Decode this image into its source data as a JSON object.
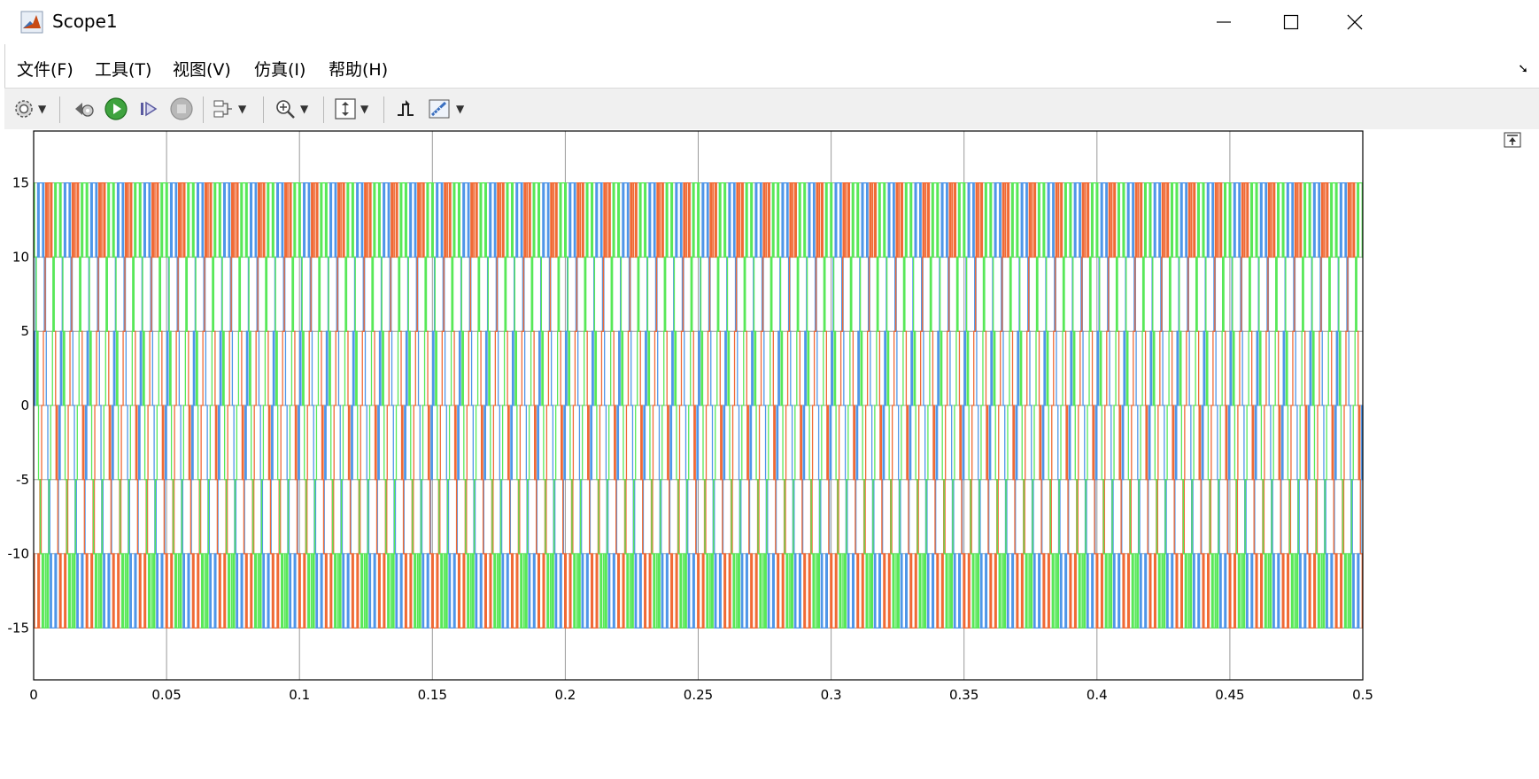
{
  "window": {
    "title": "Scope1",
    "controls": [
      "minimize",
      "maximize",
      "close"
    ]
  },
  "menu": {
    "items": [
      {
        "label": "文件(F)"
      },
      {
        "label": "工具(T)"
      },
      {
        "label": "视图(V)"
      },
      {
        "label": "仿真(I)"
      },
      {
        "label": "帮助(H)"
      }
    ]
  },
  "toolbar": {
    "icons": [
      "gear-icon",
      "step-back-icon",
      "run-icon",
      "step-forward-icon",
      "stop-icon",
      "signal-select-icon",
      "zoom-in-icon",
      "scale-axes-icon",
      "triggers-icon",
      "measure-icon"
    ]
  },
  "chart_data": {
    "type": "line",
    "xlim": [
      0,
      0.5
    ],
    "ylim": [
      -18.5,
      18.5
    ],
    "x_ticks": [
      "0",
      "0.05",
      "0.1",
      "0.15",
      "0.2",
      "0.25",
      "0.3",
      "0.35",
      "0.4",
      "0.45",
      "0.5"
    ],
    "y_ticks": [
      "15",
      "10",
      "5",
      "0",
      "-5",
      "-10",
      "-15"
    ],
    "grid": true,
    "background": "#ffffff",
    "waveform": "three-phase stepped (multilevel) voltage, levels 0, ±5, ±10, ±15",
    "fundamental_hz": 100,
    "peak": 15,
    "series": [
      {
        "color": "#4f96e8",
        "phase_deg": 0
      },
      {
        "color": "#f06a35",
        "phase_deg": -120
      },
      {
        "color": "#58e858",
        "phase_deg": 120
      }
    ]
  },
  "colors": {
    "axes_frame": "#000000",
    "grid": "#9a9a9a",
    "toolbar_bg": "#f0f0f0"
  }
}
